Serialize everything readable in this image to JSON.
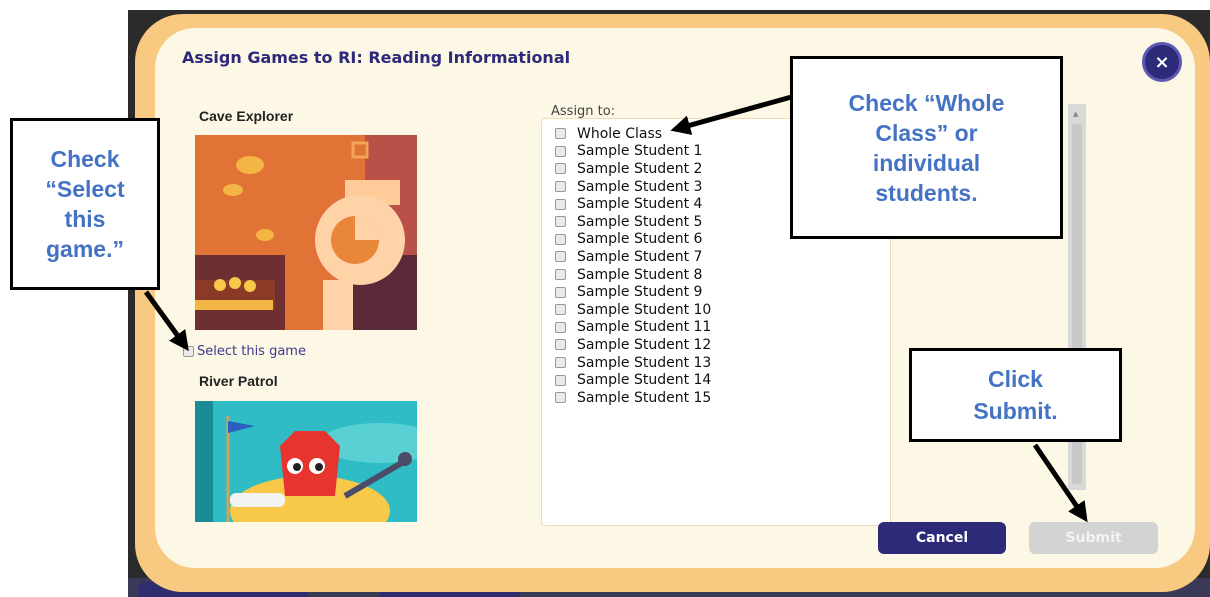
{
  "dialog": {
    "title": "Assign Games to RI: Reading Informational",
    "close_label": "×"
  },
  "games": [
    {
      "name": "Cave Explorer",
      "image": "cave-explorer-thumbnail",
      "select_label": "Select this game"
    },
    {
      "name": "River Patrol",
      "image": "river-patrol-thumbnail"
    }
  ],
  "assign": {
    "label": "Assign to:",
    "options": [
      "Whole Class",
      "Sample Student 1",
      "Sample Student 2",
      "Sample Student 3",
      "Sample Student 4",
      "Sample Student 5",
      "Sample Student 6",
      "Sample Student 7",
      "Sample Student 8",
      "Sample Student 9",
      "Sample Student 10",
      "Sample Student 11",
      "Sample Student 12",
      "Sample Student 13",
      "Sample Student 14",
      "Sample Student 15"
    ]
  },
  "buttons": {
    "cancel": "Cancel",
    "submit": "Submit"
  },
  "callouts": {
    "select_game": [
      "Check",
      "“Select",
      "this",
      "game.”"
    ],
    "whole_class": [
      "Check “Whole",
      "Class” or",
      "individual",
      "students."
    ],
    "submit": [
      "Click",
      "Submit."
    ]
  },
  "colors": {
    "accent": "#2d2a7a",
    "modal_border": "#f8c980",
    "modal_bg": "#fdf7e5",
    "callout_text": "#4472c4",
    "submit_disabled": "#d3d3d3"
  }
}
